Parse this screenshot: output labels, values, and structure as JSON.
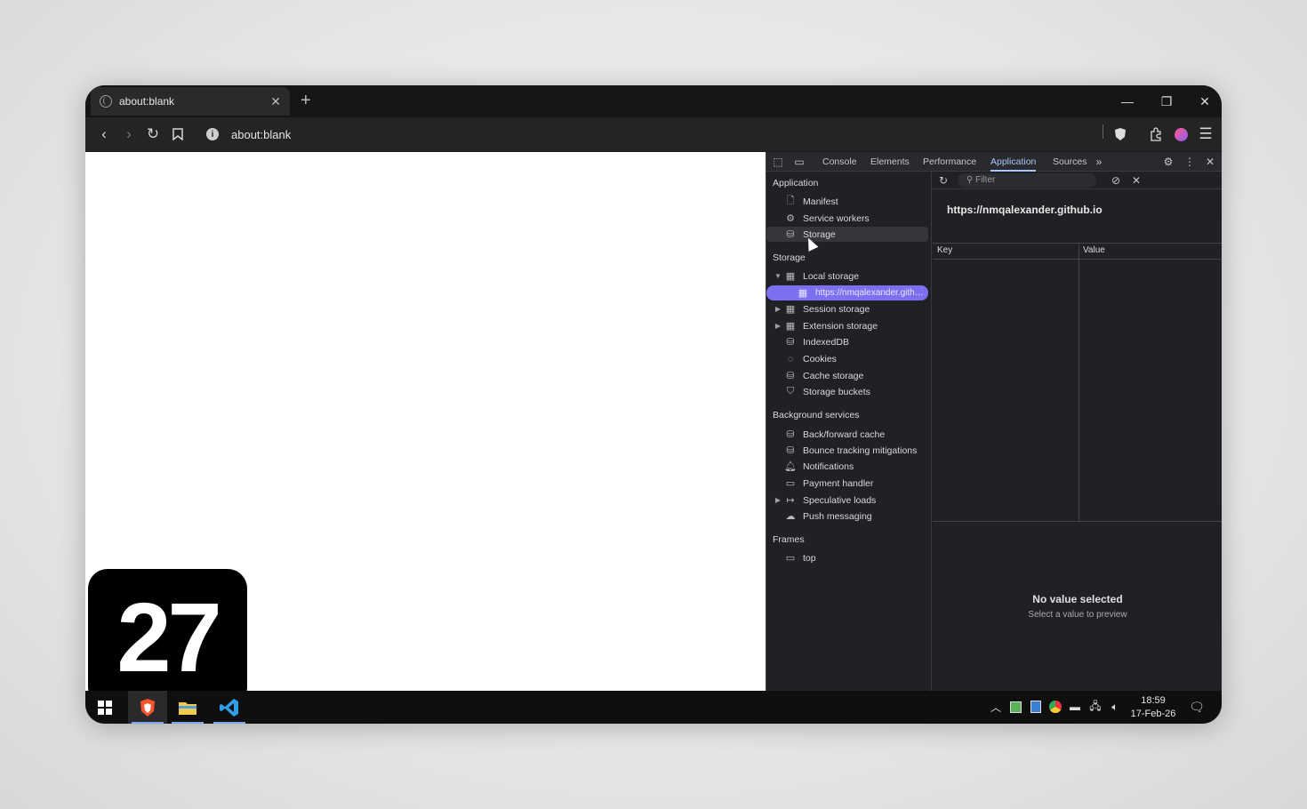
{
  "browser": {
    "tab_title": "about:blank",
    "url": "about:blank"
  },
  "page": {
    "badge_number": "27"
  },
  "devtools": {
    "tabs": [
      "Console",
      "Elements",
      "Performance",
      "Application",
      "Sources"
    ],
    "active_tab": "Application",
    "sidebar": {
      "application_header": "Application",
      "application_items": [
        "Manifest",
        "Service workers",
        "Storage"
      ],
      "storage_header": "Storage",
      "local_storage": "Local storage",
      "local_storage_child": "https://nmqalexander.gith…",
      "session_storage": "Session storage",
      "extension_storage": "Extension storage",
      "indexeddb": "IndexedDB",
      "cookies": "Cookies",
      "cache_storage": "Cache storage",
      "storage_buckets": "Storage buckets",
      "background_header": "Background services",
      "background_items": [
        "Back/forward cache",
        "Bounce tracking mitigations",
        "Notifications",
        "Payment handler",
        "Speculative loads",
        "Push messaging"
      ],
      "frames_header": "Frames",
      "frames_items": [
        "top"
      ]
    },
    "main": {
      "filter_placeholder": "Filter",
      "origin": "https://nmqalexander.github.io",
      "col_key": "Key",
      "col_value": "Value",
      "no_value_title": "No value selected",
      "no_value_sub": "Select a value to preview"
    }
  },
  "taskbar": {
    "time": "18:59",
    "date": "17-Feb-26"
  }
}
